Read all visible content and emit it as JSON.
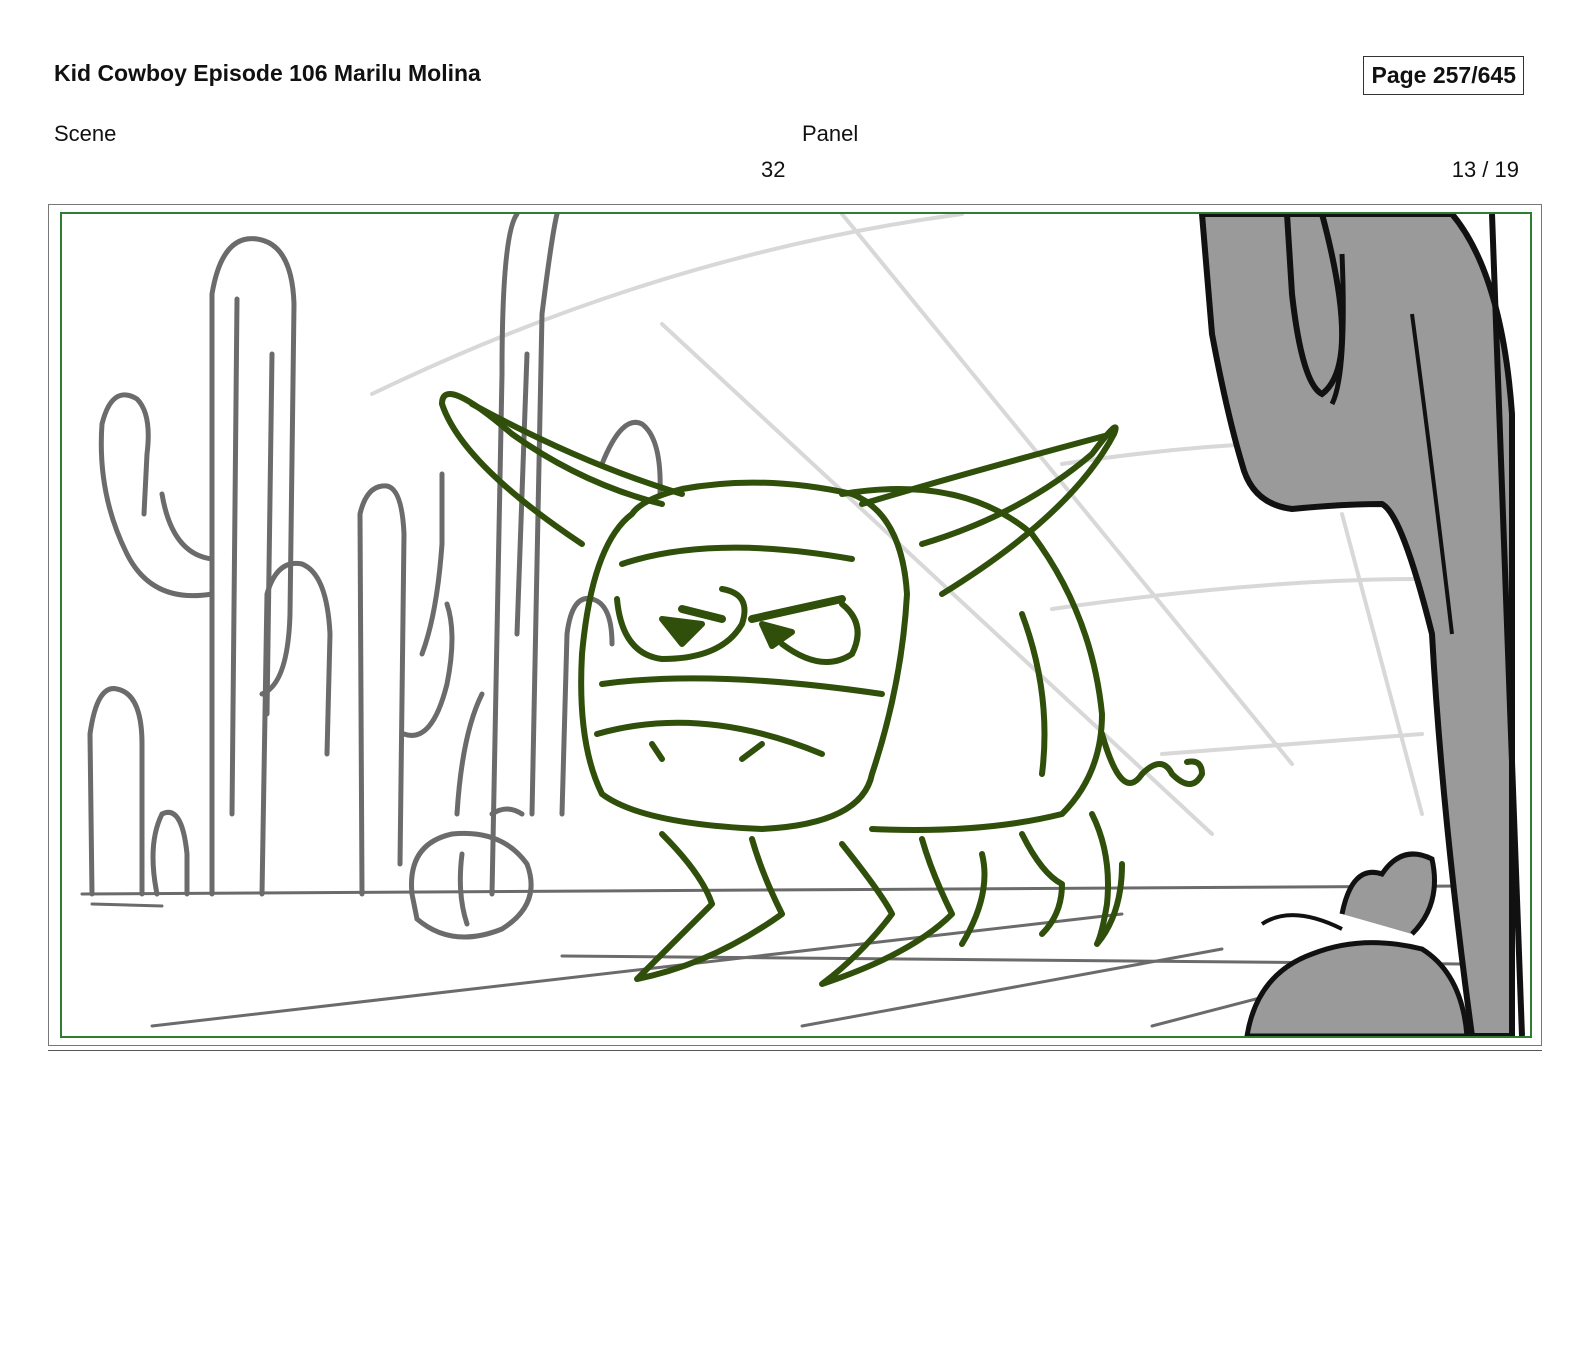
{
  "header": {
    "title": "Kid Cowboy Episode 106 Marilu Molina",
    "page": "Page 257/645"
  },
  "fields": {
    "scene_label": "Scene",
    "panel_label": "Panel",
    "scene_value": "32",
    "panel_value": "13 / 19"
  },
  "colors": {
    "bull_line": "#2f4f0a",
    "background_lines": "#6b6b6b",
    "frame_border": "#2e7d32",
    "cactus_fill": "#9a9a9a"
  },
  "drawing": {
    "subject": "bull-sketch",
    "elements": [
      "background-cacti",
      "bull",
      "foreground-cactus",
      "bush",
      "ground-lines"
    ]
  }
}
